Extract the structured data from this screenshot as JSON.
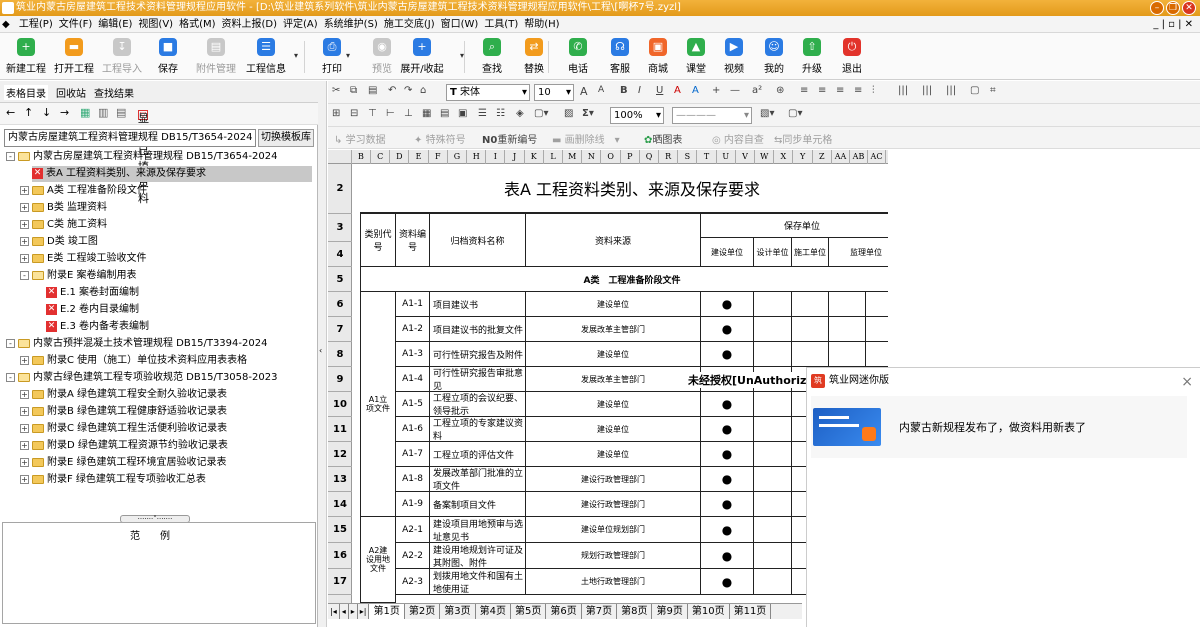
{
  "window": {
    "title": "筑业内蒙古房屋建筑工程技术资料管理规程应用软件 - [D:\\筑业建筑系列软件\\筑业内蒙古房屋建筑工程技术资料管理规程应用软件\\工程\\[啊杯7号.zyzl]",
    "buttons": {
      "minimize": "–",
      "restore": "❐",
      "close": "✕"
    }
  },
  "menu": {
    "items": [
      "工程(P)",
      "文件(F)",
      "编辑(E)",
      "视图(V)",
      "格式(M)",
      "资料上报(D)",
      "评定(A)",
      "系统维护(S)",
      "施工交底(J)",
      "窗口(W)",
      "工具(T)",
      "帮助(H)"
    ],
    "right_controls": "_ | ▫ | ✕"
  },
  "toolbar": {
    "buttons": [
      {
        "label": "新建工程",
        "icon": "plus-icon",
        "color": "#2fae4c",
        "glyph": "+"
      },
      {
        "label": "打开工程",
        "icon": "folder-icon",
        "color": "#f29b1d",
        "glyph": "▬"
      },
      {
        "label": "工程导入",
        "icon": "import-icon",
        "color": "#c8c8c8",
        "glyph": "↧",
        "disabled": true
      },
      {
        "label": "保存",
        "icon": "save-icon",
        "color": "#2b7be3",
        "glyph": "■"
      },
      {
        "label": "附件管理",
        "icon": "attachment-icon",
        "color": "#c8c8c8",
        "glyph": "▤",
        "disabled": true
      },
      {
        "label": "工程信息",
        "icon": "info-icon",
        "color": "#2b7be3",
        "glyph": "☰"
      },
      {
        "label": "打印",
        "icon": "print-icon",
        "color": "#2b7be3",
        "glyph": "⎙"
      },
      {
        "label": "预览",
        "icon": "preview-icon",
        "color": "#c8c8c8",
        "glyph": "◉",
        "disabled": true
      },
      {
        "label": "展开/收起",
        "icon": "expand-icon",
        "color": "#2b7be3",
        "glyph": "+"
      },
      {
        "label": "查找",
        "icon": "find-icon",
        "color": "#2fae4c",
        "glyph": "⌕"
      },
      {
        "label": "替换",
        "icon": "replace-icon",
        "color": "#f29b1d",
        "glyph": "⇄"
      },
      {
        "label": "电话",
        "icon": "phone-icon",
        "color": "#2fae4c",
        "glyph": "✆"
      },
      {
        "label": "客服",
        "icon": "headset-icon",
        "color": "#2b7be3",
        "glyph": "☊"
      },
      {
        "label": "商城",
        "icon": "shop-icon",
        "color": "#f0662a",
        "glyph": "▣"
      },
      {
        "label": "课堂",
        "icon": "class-icon",
        "color": "#2fae4c",
        "glyph": "▲"
      },
      {
        "label": "视频",
        "icon": "video-icon",
        "color": "#2b7be3",
        "glyph": "▶"
      },
      {
        "label": "我的",
        "icon": "user-icon",
        "color": "#2b7be3",
        "glyph": "☺"
      },
      {
        "label": "升级",
        "icon": "upgrade-icon",
        "color": "#2fae4c",
        "glyph": "⇧"
      },
      {
        "label": "退出",
        "icon": "power-icon",
        "color": "#e2332b",
        "glyph": "⏻"
      }
    ]
  },
  "left": {
    "tabs": [
      "表格目录",
      "回收站",
      "查找结果"
    ],
    "toolbar": {
      "show_filled": "显示已填资料"
    },
    "spec_select": "内蒙古房屋建筑工程资料管理规程 DB15/T3654-2024",
    "switch_template": "切换模板库",
    "tree": [
      {
        "label": "内蒙古房屋建筑工程资料管理规程 DB15/T3654-2024",
        "kind": "open-folder",
        "level": 0,
        "pm": "-"
      },
      {
        "label": "表A 工程资料类别、来源及保存要求",
        "kind": "doc",
        "level": 1,
        "selected": true
      },
      {
        "label": "A类 工程准备阶段文件",
        "kind": "folder",
        "level": 1,
        "pm": "+"
      },
      {
        "label": "B类 监理资料",
        "kind": "folder",
        "level": 1,
        "pm": "+"
      },
      {
        "label": "C类 施工资料",
        "kind": "folder",
        "level": 1,
        "pm": "+"
      },
      {
        "label": "D类 竣工图",
        "kind": "folder",
        "level": 1,
        "pm": "+"
      },
      {
        "label": "E类 工程竣工验收文件",
        "kind": "folder",
        "level": 1,
        "pm": "+"
      },
      {
        "label": "附录E 案卷编制用表",
        "kind": "open-folder",
        "level": 1,
        "pm": "-"
      },
      {
        "label": "E.1 案卷封面编制",
        "kind": "doc",
        "level": 2
      },
      {
        "label": "E.2 卷内目录编制",
        "kind": "doc",
        "level": 2
      },
      {
        "label": "E.3 卷内备考表编制",
        "kind": "doc",
        "level": 2
      },
      {
        "label": "内蒙古预拌混凝土技术管理规程 DB15/T3394-2024",
        "kind": "open-folder",
        "level": 0,
        "pm": "-"
      },
      {
        "label": "附录C 使用（施工）单位技术资料应用表表格",
        "kind": "folder",
        "level": 1,
        "pm": "+"
      },
      {
        "label": "内蒙古绿色建筑工程专项验收规范 DB15/T3058-2023",
        "kind": "open-folder",
        "level": 0,
        "pm": "-"
      },
      {
        "label": "附录A 绿色建筑工程安全耐久验收记录表",
        "kind": "folder",
        "level": 1,
        "pm": "+"
      },
      {
        "label": "附录B 绿色建筑工程健康舒适验收记录表",
        "kind": "folder",
        "level": 1,
        "pm": "+"
      },
      {
        "label": "附录C 绿色建筑工程生活便利验收记录表",
        "kind": "folder",
        "level": 1,
        "pm": "+"
      },
      {
        "label": "附录D 绿色建筑工程资源节约验收记录表",
        "kind": "folder",
        "level": 1,
        "pm": "+"
      },
      {
        "label": "附录E 绿色建筑工程环境宜居验收记录表",
        "kind": "folder",
        "level": 1,
        "pm": "+"
      },
      {
        "label": "附录F 绿色建筑工程专项验收汇总表",
        "kind": "folder",
        "level": 1,
        "pm": "+"
      }
    ],
    "example_title": "范例"
  },
  "format": {
    "font_name": "宋体",
    "font_size": "10",
    "zoom": "100%",
    "bar3": [
      "学习数据",
      "特殊符号",
      "重新编号",
      "画删除线",
      "晒图表",
      "内容自查",
      "同步单元格"
    ]
  },
  "sheet": {
    "columns": [
      "B",
      "C",
      "D",
      "E",
      "F",
      "G",
      "H",
      "I",
      "J",
      "K",
      "L",
      "M",
      "N",
      "O",
      "P",
      "Q",
      "R",
      "S",
      "T",
      "U",
      "V",
      "W",
      "X",
      "Y",
      "Z",
      "AA",
      "AB",
      "AC"
    ],
    "row_numbers": [
      "2",
      "3",
      "4",
      "5",
      "6",
      "7",
      "8",
      "9",
      "10",
      "11",
      "12",
      "13",
      "14",
      "15",
      "16",
      "17"
    ],
    "title": "表A 工程资料类别、来源及保存要求",
    "headers": {
      "category_code": "类别代号",
      "doc_no": "资料编号",
      "doc_name": "归档资料名称",
      "source": "资料来源",
      "keep_unit": "保存单位",
      "build": "建设单位",
      "design": "设计单位",
      "construct": "施工单位",
      "supervise": "监理单位"
    },
    "section_a": "A类　工程准备阶段文件",
    "group_a1": "A1立项文件",
    "group_a2": "A2建设用地文件",
    "rows": [
      {
        "no": "A1-1",
        "name": "项目建议书",
        "src": "建设单位",
        "dot": "●"
      },
      {
        "no": "A1-2",
        "name": "项目建议书的批复文件",
        "src": "发展改革主管部门",
        "dot": "●"
      },
      {
        "no": "A1-3",
        "name": "可行性研究报告及附件",
        "src": "建设单位",
        "dot": "●"
      },
      {
        "no": "A1-4",
        "name": "可行性研究报告审批意见",
        "src": "发展改革主管部门",
        "dot": "●"
      },
      {
        "no": "A1-5",
        "name": "工程立项的会议纪要、领导批示",
        "src": "建设单位",
        "dot": "●"
      },
      {
        "no": "A1-6",
        "name": "工程立项的专家建议资料",
        "src": "建设单位",
        "dot": "●"
      },
      {
        "no": "A1-7",
        "name": "工程立项的评估文件",
        "src": "建设单位",
        "dot": "●"
      },
      {
        "no": "A1-8",
        "name": "发展改革部门批准的立项文件",
        "src": "建设行政管理部门",
        "dot": "●"
      },
      {
        "no": "A1-9",
        "name": "备案制项目文件",
        "src": "建设行政管理部门",
        "dot": "●"
      },
      {
        "no": "A2-1",
        "name": "建设项目用地预审与选址意见书",
        "src": "建设单位规划部门",
        "dot": "●"
      },
      {
        "no": "A2-2",
        "name": "建设用地规划许可证及其附图、附件",
        "src": "规划行政管理部门",
        "dot": "●"
      },
      {
        "no": "A2-3",
        "name": "划拨用地文件和国有土地使用证",
        "src": "土地行政管理部门",
        "dot": "●"
      }
    ],
    "tabs": [
      "第1页",
      "第2页",
      "第3页",
      "第4页",
      "第5页",
      "第6页",
      "第7页",
      "第8页",
      "第9页",
      "第10页",
      "第11页"
    ]
  },
  "watermark": "未经授权[UnAuthoriz",
  "popup": {
    "app": "筑业网迷你版",
    "message": "内蒙古新规程发布了，做资料用新表了",
    "close": "×"
  }
}
